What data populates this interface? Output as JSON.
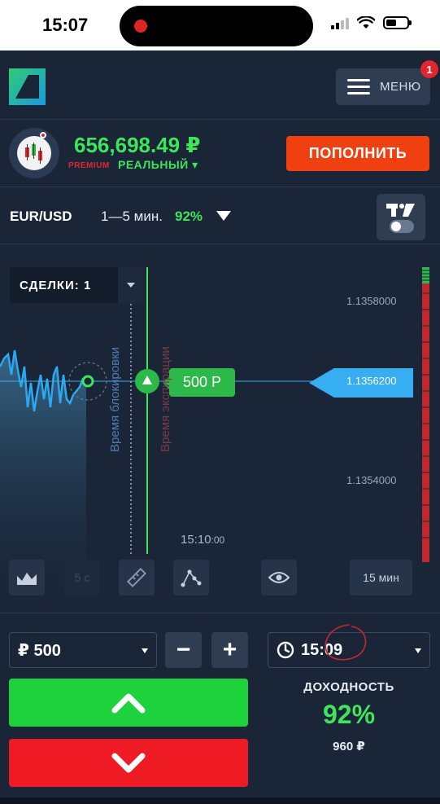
{
  "status_bar": {
    "time": "15:07"
  },
  "header": {
    "menu_label": "МЕНЮ",
    "menu_badge": "1"
  },
  "account": {
    "balance": "656,698.49 ₽",
    "tier": "PREMIUM",
    "type": "РЕАЛЬНЫЙ ▾",
    "deposit_label": "ПОПОЛНИТЬ"
  },
  "asset": {
    "pair": "EUR/USD",
    "duration": "1—5 мин.",
    "payout": "92%"
  },
  "chart": {
    "deals_label": "СДЕЛКИ: 1",
    "prices": [
      "1.1358000",
      "1.1354000"
    ],
    "current_price": "1.1356200",
    "trade_amount": "500 Р",
    "lock_label": "Время блокировки",
    "expiry_label": "Время экспирации",
    "time_main": "15:10",
    "time_sec": ":00",
    "ghost_tool": "5 с",
    "timeframe": "15 мин"
  },
  "trade": {
    "amount": "₽ 500",
    "minus": "−",
    "plus": "+",
    "expiry_time": "15:09",
    "yield_label": "ДОХОДНОСТЬ",
    "yield_pct": "92%",
    "yield_amount": "960 ₽"
  },
  "colors": {
    "up": "#1ed23e",
    "down": "#ee1b24",
    "accent_green": "#3ee45a",
    "price_tag": "#38aef2",
    "deposit": "#f0400f"
  }
}
